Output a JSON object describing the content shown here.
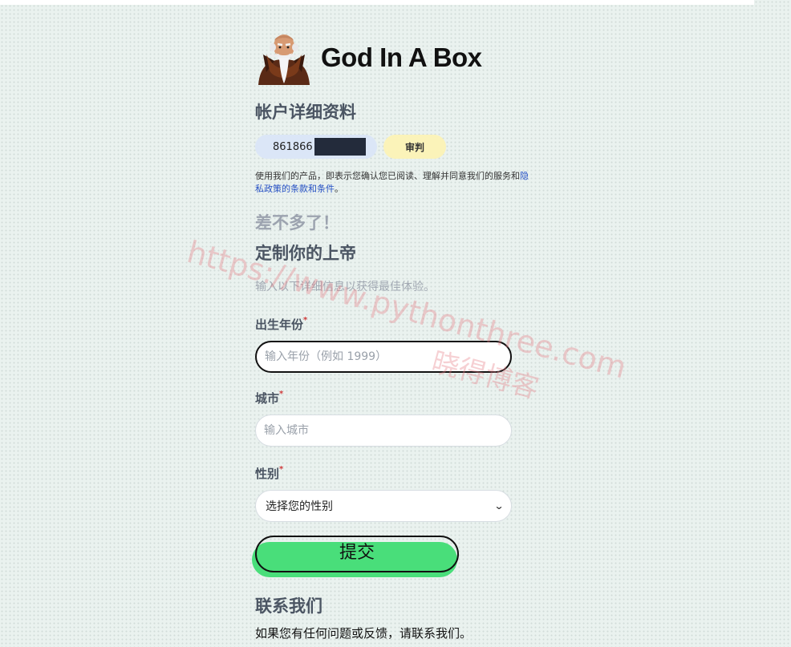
{
  "app": {
    "name": "God In A Box"
  },
  "account": {
    "title": "帐户详细资料",
    "phone_prefix": "861866",
    "plan_badge": "审判"
  },
  "terms": {
    "text_before": "使用我们的产品，即表示您确认您已阅读、理解并同意我们的服务和",
    "link": "隐私政策的条款和条件",
    "text_after": "。"
  },
  "onboarding": {
    "almost": "差不多了！",
    "title": "定制你的上帝",
    "subtitle": "输入以下详细信息以获得最佳体验。"
  },
  "form": {
    "required_mark": "*",
    "birth_year": {
      "label": "出生年份",
      "placeholder": "输入年份（例如 1999）",
      "value": ""
    },
    "city": {
      "label": "城市",
      "placeholder": "输入城市",
      "value": ""
    },
    "gender": {
      "label": "性别",
      "selected": "选择您的性别"
    },
    "submit": "提交"
  },
  "contact": {
    "title": "联系我们",
    "text": "如果您有任何问题或反馈，请联系我们。"
  },
  "watermark": {
    "url": "https://www.pythonthree.com",
    "name": "晓得博客"
  },
  "colors": {
    "background": "#eaf2ef",
    "submit_green": "#49de7a",
    "id_pill": "#dbe6f7",
    "badge_yellow": "#fbf3b9",
    "link_blue": "#2650c4"
  }
}
